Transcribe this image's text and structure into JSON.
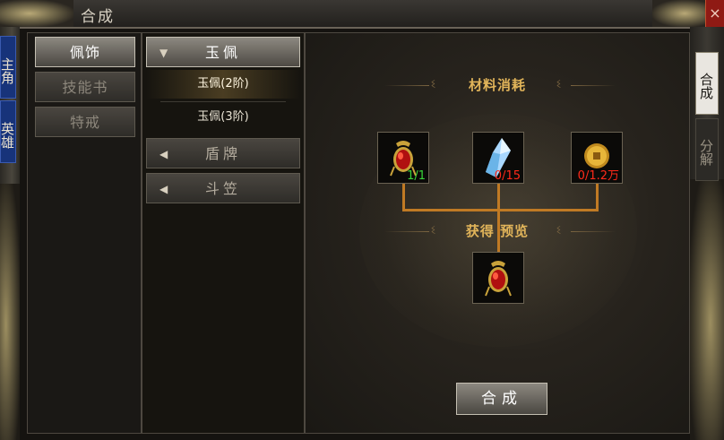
{
  "window": {
    "title": "合成",
    "close_glyph": "×"
  },
  "left_tabs": [
    {
      "label": "主角"
    },
    {
      "label": "英雄"
    }
  ],
  "right_tabs": [
    {
      "label": "合成",
      "active": true
    },
    {
      "label": "分解",
      "active": false
    }
  ],
  "categories": [
    {
      "label": "佩饰",
      "active": true
    },
    {
      "label": "技能书",
      "active": false
    },
    {
      "label": "特戒",
      "active": false
    }
  ],
  "subcategories": {
    "open": {
      "label": "玉佩",
      "items": [
        {
          "label": "玉佩(2阶)",
          "selected": true
        },
        {
          "label": "玉佩(3阶)",
          "selected": false
        }
      ]
    },
    "closed": [
      {
        "label": "盾牌"
      },
      {
        "label": "斗笠"
      }
    ]
  },
  "materials": {
    "title": "材料消耗",
    "items": [
      {
        "icon": "jade-pendant-icon",
        "count": "1/1",
        "status": "ok"
      },
      {
        "icon": "crystal-icon",
        "count": "0/15",
        "status": "bad"
      },
      {
        "icon": "gold-coin-icon",
        "count": "0/1.2万",
        "status": "bad"
      }
    ]
  },
  "result": {
    "title": "获得 预览",
    "icon": "jade-pendant-icon"
  },
  "craft_button": "合成",
  "colors": {
    "accent": "#e2b55a",
    "ok": "#39d439",
    "bad": "#ff2a1a",
    "connector": "#c07a24"
  }
}
